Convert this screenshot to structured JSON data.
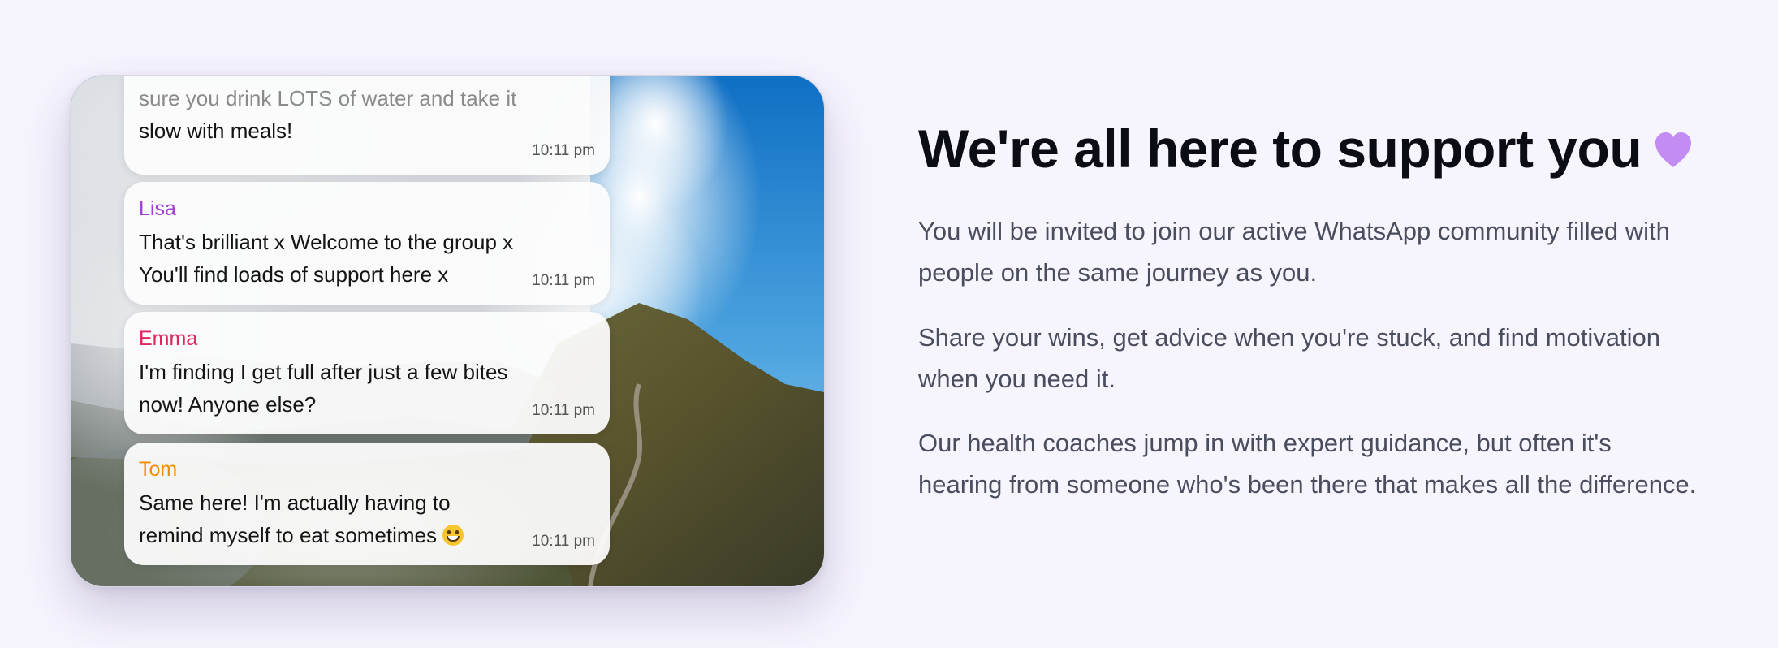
{
  "chat": {
    "messages": [
      {
        "sender": "",
        "text_faded": "sure you drink LOTS of water and take it",
        "text": "slow with meals!",
        "time": "10:11 pm"
      },
      {
        "sender": "Lisa",
        "sender_color": "#a13fd4",
        "text": "That's brilliant x Welcome to the group x You'll find loads of support here x",
        "time": "10:11 pm"
      },
      {
        "sender": "Emma",
        "sender_color": "#e0245e",
        "text": "I'm finding I get full after just a few bites now! Anyone else?",
        "time": "10:11 pm"
      },
      {
        "sender": "Tom",
        "sender_color": "#f08c00",
        "text": "Same here! I'm actually having to remind myself to eat sometimes",
        "emoji": "grinning-face",
        "time": "10:11 pm"
      }
    ]
  },
  "section": {
    "title": "We're all here to support you",
    "heart_icon": "purple-heart",
    "heart_color": "#c28cf2",
    "paragraphs": [
      "You will be invited to join our active WhatsApp community filled with people on the same journey as you.",
      "Share your wins, get advice when you're stuck, and find motivation when you need it.",
      "Our health coaches jump in with expert guidance, but often it's hearing from someone who's been there that makes all the difference."
    ]
  }
}
